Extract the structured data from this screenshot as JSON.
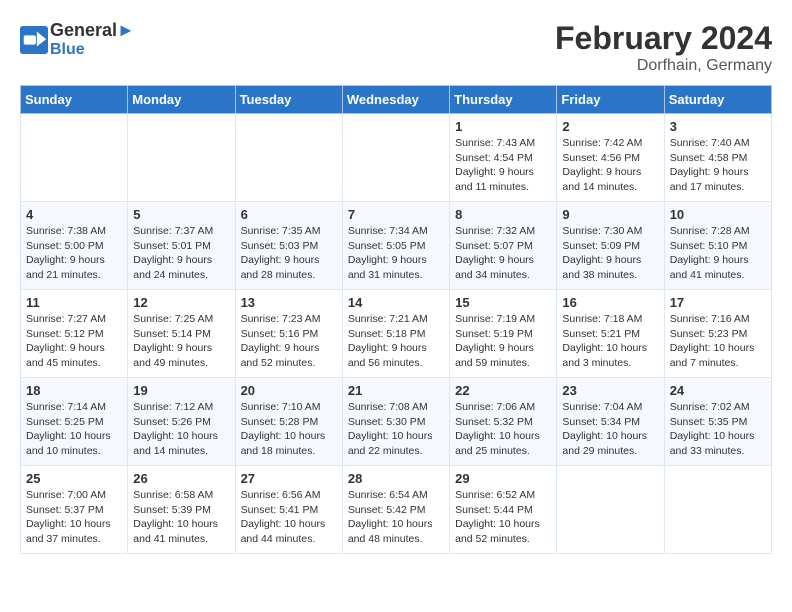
{
  "header": {
    "logo_line1": "General",
    "logo_line2": "Blue",
    "month": "February 2024",
    "location": "Dorfhain, Germany"
  },
  "days_of_week": [
    "Sunday",
    "Monday",
    "Tuesday",
    "Wednesday",
    "Thursday",
    "Friday",
    "Saturday"
  ],
  "weeks": [
    [
      {
        "day": "",
        "info": ""
      },
      {
        "day": "",
        "info": ""
      },
      {
        "day": "",
        "info": ""
      },
      {
        "day": "",
        "info": ""
      },
      {
        "day": "1",
        "info": "Sunrise: 7:43 AM\nSunset: 4:54 PM\nDaylight: 9 hours\nand 11 minutes."
      },
      {
        "day": "2",
        "info": "Sunrise: 7:42 AM\nSunset: 4:56 PM\nDaylight: 9 hours\nand 14 minutes."
      },
      {
        "day": "3",
        "info": "Sunrise: 7:40 AM\nSunset: 4:58 PM\nDaylight: 9 hours\nand 17 minutes."
      }
    ],
    [
      {
        "day": "4",
        "info": "Sunrise: 7:38 AM\nSunset: 5:00 PM\nDaylight: 9 hours\nand 21 minutes."
      },
      {
        "day": "5",
        "info": "Sunrise: 7:37 AM\nSunset: 5:01 PM\nDaylight: 9 hours\nand 24 minutes."
      },
      {
        "day": "6",
        "info": "Sunrise: 7:35 AM\nSunset: 5:03 PM\nDaylight: 9 hours\nand 28 minutes."
      },
      {
        "day": "7",
        "info": "Sunrise: 7:34 AM\nSunset: 5:05 PM\nDaylight: 9 hours\nand 31 minutes."
      },
      {
        "day": "8",
        "info": "Sunrise: 7:32 AM\nSunset: 5:07 PM\nDaylight: 9 hours\nand 34 minutes."
      },
      {
        "day": "9",
        "info": "Sunrise: 7:30 AM\nSunset: 5:09 PM\nDaylight: 9 hours\nand 38 minutes."
      },
      {
        "day": "10",
        "info": "Sunrise: 7:28 AM\nSunset: 5:10 PM\nDaylight: 9 hours\nand 41 minutes."
      }
    ],
    [
      {
        "day": "11",
        "info": "Sunrise: 7:27 AM\nSunset: 5:12 PM\nDaylight: 9 hours\nand 45 minutes."
      },
      {
        "day": "12",
        "info": "Sunrise: 7:25 AM\nSunset: 5:14 PM\nDaylight: 9 hours\nand 49 minutes."
      },
      {
        "day": "13",
        "info": "Sunrise: 7:23 AM\nSunset: 5:16 PM\nDaylight: 9 hours\nand 52 minutes."
      },
      {
        "day": "14",
        "info": "Sunrise: 7:21 AM\nSunset: 5:18 PM\nDaylight: 9 hours\nand 56 minutes."
      },
      {
        "day": "15",
        "info": "Sunrise: 7:19 AM\nSunset: 5:19 PM\nDaylight: 9 hours\nand 59 minutes."
      },
      {
        "day": "16",
        "info": "Sunrise: 7:18 AM\nSunset: 5:21 PM\nDaylight: 10 hours\nand 3 minutes."
      },
      {
        "day": "17",
        "info": "Sunrise: 7:16 AM\nSunset: 5:23 PM\nDaylight: 10 hours\nand 7 minutes."
      }
    ],
    [
      {
        "day": "18",
        "info": "Sunrise: 7:14 AM\nSunset: 5:25 PM\nDaylight: 10 hours\nand 10 minutes."
      },
      {
        "day": "19",
        "info": "Sunrise: 7:12 AM\nSunset: 5:26 PM\nDaylight: 10 hours\nand 14 minutes."
      },
      {
        "day": "20",
        "info": "Sunrise: 7:10 AM\nSunset: 5:28 PM\nDaylight: 10 hours\nand 18 minutes."
      },
      {
        "day": "21",
        "info": "Sunrise: 7:08 AM\nSunset: 5:30 PM\nDaylight: 10 hours\nand 22 minutes."
      },
      {
        "day": "22",
        "info": "Sunrise: 7:06 AM\nSunset: 5:32 PM\nDaylight: 10 hours\nand 25 minutes."
      },
      {
        "day": "23",
        "info": "Sunrise: 7:04 AM\nSunset: 5:34 PM\nDaylight: 10 hours\nand 29 minutes."
      },
      {
        "day": "24",
        "info": "Sunrise: 7:02 AM\nSunset: 5:35 PM\nDaylight: 10 hours\nand 33 minutes."
      }
    ],
    [
      {
        "day": "25",
        "info": "Sunrise: 7:00 AM\nSunset: 5:37 PM\nDaylight: 10 hours\nand 37 minutes."
      },
      {
        "day": "26",
        "info": "Sunrise: 6:58 AM\nSunset: 5:39 PM\nDaylight: 10 hours\nand 41 minutes."
      },
      {
        "day": "27",
        "info": "Sunrise: 6:56 AM\nSunset: 5:41 PM\nDaylight: 10 hours\nand 44 minutes."
      },
      {
        "day": "28",
        "info": "Sunrise: 6:54 AM\nSunset: 5:42 PM\nDaylight: 10 hours\nand 48 minutes."
      },
      {
        "day": "29",
        "info": "Sunrise: 6:52 AM\nSunset: 5:44 PM\nDaylight: 10 hours\nand 52 minutes."
      },
      {
        "day": "",
        "info": ""
      },
      {
        "day": "",
        "info": ""
      }
    ]
  ]
}
